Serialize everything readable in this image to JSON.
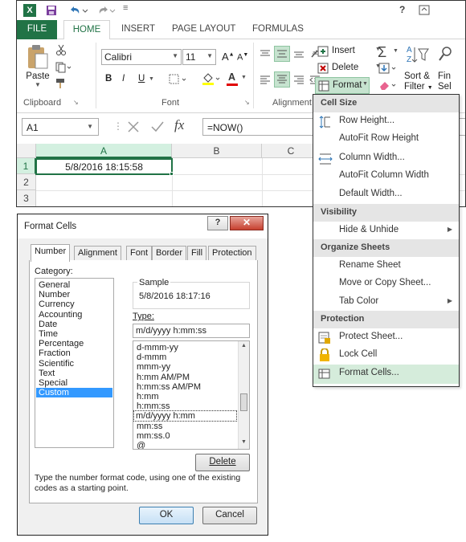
{
  "quick_access": {
    "help": "?"
  },
  "ribbon_tabs": [
    "FILE",
    "HOME",
    "INSERT",
    "PAGE LAYOUT",
    "FORMULAS"
  ],
  "ribbon": {
    "paste": "Paste",
    "font_name": "Calibri",
    "font_size": "11",
    "bold": "B",
    "italic": "I",
    "underline": "U",
    "grow_font": "A",
    "shrink_font": "A",
    "font_color": "A",
    "insert": "Insert",
    "delete": "Delete",
    "format": "Format",
    "sort_filter_line1": "Sort &",
    "sort_filter_line2": "Filter",
    "find_line1": "Fin",
    "find_line2": "Sel",
    "groups": {
      "clipboard": "Clipboard",
      "font": "Font",
      "alignment": "Alignment"
    }
  },
  "formula_bar": {
    "name_box": "A1",
    "fx": "fx",
    "formula": "=NOW()"
  },
  "sheet": {
    "columns": [
      "A",
      "B",
      "C"
    ],
    "rows": [
      "1",
      "2",
      "3"
    ],
    "a1_value": "5/8/2016 18:15:58"
  },
  "format_menu": {
    "sections": [
      {
        "title": "Cell Size",
        "items": [
          "Row Height...",
          "AutoFit Row Height",
          "Column Width...",
          "AutoFit Column Width",
          "Default Width..."
        ]
      },
      {
        "title": "Visibility",
        "items": [
          "Hide & Unhide"
        ]
      },
      {
        "title": "Organize Sheets",
        "items": [
          "Rename Sheet",
          "Move or Copy Sheet...",
          "Tab Color"
        ]
      },
      {
        "title": "Protection",
        "items": [
          "Protect Sheet...",
          "Lock Cell",
          "Format Cells..."
        ]
      }
    ]
  },
  "dialog": {
    "title": "Format Cells",
    "help": "?",
    "tabs": [
      "Number",
      "Alignment",
      "Font",
      "Border",
      "Fill",
      "Protection"
    ],
    "category_label": "Category:",
    "categories": [
      "General",
      "Number",
      "Currency",
      "Accounting",
      "Date",
      "Time",
      "Percentage",
      "Fraction",
      "Scientific",
      "Text",
      "Special",
      "Custom"
    ],
    "selected_category": "Custom",
    "sample_label": "Sample",
    "sample_value": "5/8/2016 18:17:16",
    "type_label": "Type:",
    "type_value": "m/d/yyyy h:mm:ss",
    "type_list": [
      "d-mmm-yy",
      "d-mmm",
      "mmm-yy",
      "h:mm AM/PM",
      "h:mm:ss AM/PM",
      "h:mm",
      "h:mm:ss",
      "m/d/yyyy h:mm",
      "mm:ss",
      "mm:ss.0",
      "@"
    ],
    "delete_button": "Delete",
    "description": [
      "Type the number format code, using one of the existing",
      "codes as a starting point."
    ],
    "ok_button": "OK",
    "cancel_button": "Cancel"
  },
  "colors": {
    "excel_green": "#217346",
    "selection_blue": "#3399ff",
    "menu_hover": "#d5ecdb"
  }
}
